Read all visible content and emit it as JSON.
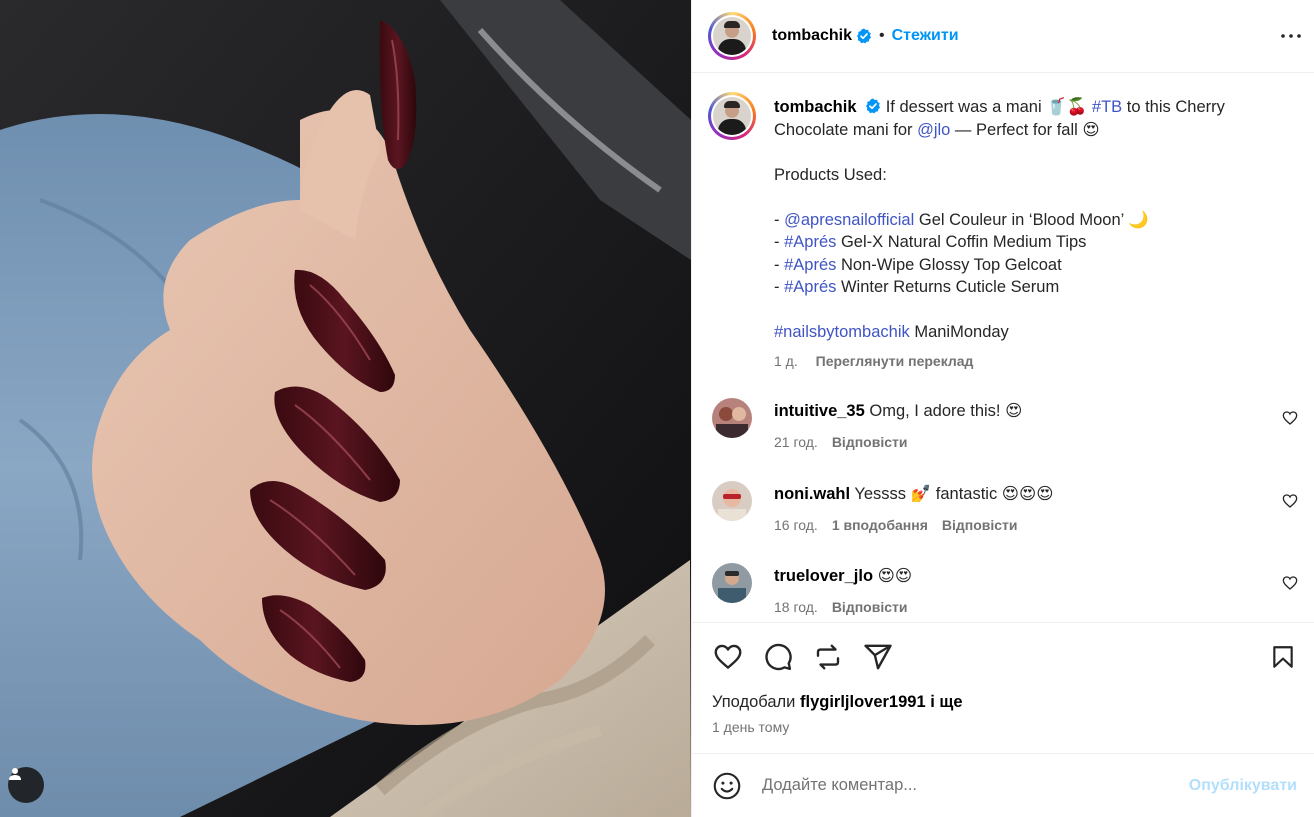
{
  "post": {
    "username": "tombachik",
    "follow_label": "Стежити",
    "separator": "•"
  },
  "caption": {
    "username": "tombachik",
    "line1_text_a": " If dessert was a mani ",
    "emoji_1": "🥤🍒",
    "hashtag_tb": "#TB",
    "line1_text_b": " to this Cherry Chocolate mani for ",
    "mention_jlo": "@jlo",
    "line1_text_c": " — Perfect for fall ",
    "emoji_2": "😍",
    "products_heading": "Products Used:",
    "items": [
      {
        "prefix": "- ",
        "tag": "@apresnailofficial",
        "text": " Gel Couleur in ‘Blood Moon’ ",
        "emoji": "🌙"
      },
      {
        "prefix": "- ",
        "tag": "#Aprés",
        "text": " Gel-X Natural Coffin Medium Tips",
        "emoji": ""
      },
      {
        "prefix": "- ",
        "tag": "#Aprés",
        "text": " Non-Wipe Glossy Top Gelcoat",
        "emoji": ""
      },
      {
        "prefix": "- ",
        "tag": "#Aprés",
        "text": " Winter Returns Cuticle Serum",
        "emoji": ""
      }
    ],
    "footer_tag": "#nailsbytombachik",
    "footer_text": " ManiMonday",
    "time": "1 д.",
    "translate_label": "Переглянути переклад"
  },
  "comments": [
    {
      "username": "intuitive_35",
      "text": " Omg, I adore this! 😍",
      "time": "21 год.",
      "likes": "",
      "reply": "Відповісти"
    },
    {
      "username": "noni.wahl",
      "text": " Yessss 💅 fantastic 😍😍😍",
      "time": "16 год.",
      "likes": "1 вподобання",
      "reply": "Відповісти"
    },
    {
      "username": "truelover_jlo",
      "text": " 😍😍",
      "time": "18 год.",
      "likes": "",
      "reply": "Відповісти"
    }
  ],
  "likes_bar": {
    "prefix": "Уподобали ",
    "user": "flygirljlover1991",
    "suffix": " і ще",
    "date": "1 день тому"
  },
  "add_comment": {
    "placeholder": "Додайте коментар...",
    "publish_label": "Опублікувати"
  },
  "colors": {
    "link": "#4055c4",
    "follow": "#0095f6",
    "publish_disabled": "#b2dffc",
    "nail": "#4a0f16"
  },
  "icons": [
    "verified-badge-icon",
    "more-options-icon",
    "heart-icon",
    "comment-icon",
    "repost-icon",
    "share-icon",
    "bookmark-icon",
    "emoji-icon",
    "user-tag-icon"
  ]
}
